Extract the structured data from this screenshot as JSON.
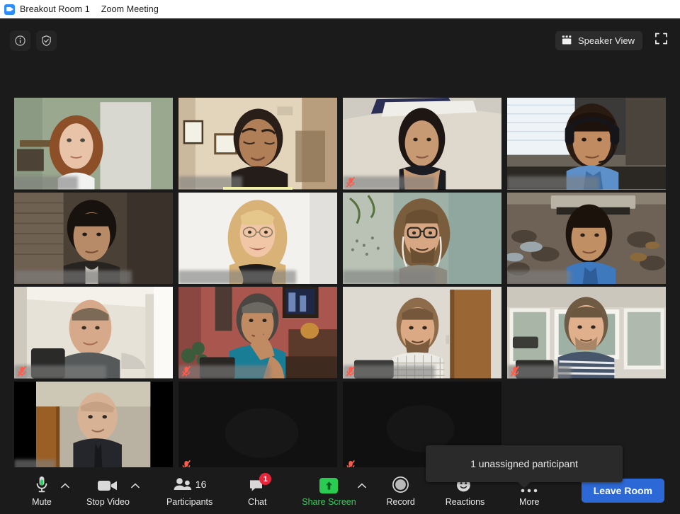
{
  "titlebar": {
    "room": "Breakout Room 1",
    "app": "Zoom Meeting",
    "logo_icon": "zoom-camera-icon"
  },
  "topbar": {
    "info_icon": "info-circle-icon",
    "encryption_icon": "shield-check-icon",
    "view_button": {
      "label": "Speaker View",
      "icon": "gallery-grid-icon"
    },
    "fullscreen_icon": "fullscreen-expand-icon"
  },
  "tooltip": {
    "text": "1 unassigned participant"
  },
  "gallery": {
    "rows": 4,
    "columns": 4,
    "tiles": [
      {
        "id": 1,
        "video": true,
        "muted": false,
        "active_speaker": false,
        "speaking_bar": false,
        "name_label_width": "w-sm"
      },
      {
        "id": 2,
        "video": true,
        "muted": false,
        "active_speaker": false,
        "speaking_bar": true,
        "name_label_width": "w-sm"
      },
      {
        "id": 3,
        "video": true,
        "muted": true,
        "active_speaker": false,
        "speaking_bar": false,
        "name_label_width": "w-md"
      },
      {
        "id": 4,
        "video": true,
        "muted": false,
        "active_speaker": true,
        "speaking_bar": false,
        "name_label_width": "w-md"
      },
      {
        "id": 5,
        "video": true,
        "muted": false,
        "active_speaker": false,
        "speaking_bar": false,
        "name_label_width": "w-lg"
      },
      {
        "id": 6,
        "video": true,
        "muted": false,
        "active_speaker": false,
        "speaking_bar": false,
        "name_label_width": "w-lg"
      },
      {
        "id": 7,
        "video": true,
        "muted": false,
        "active_speaker": false,
        "speaking_bar": false,
        "name_label_width": "w-md"
      },
      {
        "id": 8,
        "video": true,
        "muted": false,
        "active_speaker": false,
        "speaking_bar": false,
        "name_label_width": "w-sm"
      },
      {
        "id": 9,
        "video": true,
        "muted": true,
        "active_speaker": false,
        "speaking_bar": false,
        "name_label_width": "w-md"
      },
      {
        "id": 10,
        "video": true,
        "muted": true,
        "active_speaker": false,
        "speaking_bar": false,
        "name_label_width": "w-md"
      },
      {
        "id": 11,
        "video": true,
        "muted": true,
        "active_speaker": false,
        "speaking_bar": false,
        "name_label_width": "w-md"
      },
      {
        "id": 12,
        "video": true,
        "muted": true,
        "active_speaker": false,
        "speaking_bar": false,
        "name_label_width": "w-sm"
      },
      {
        "id": 13,
        "video": true,
        "muted": false,
        "active_speaker": false,
        "speaking_bar": false,
        "name_label_width": "w-xs"
      },
      {
        "id": 14,
        "video": false,
        "muted": true,
        "active_speaker": false,
        "speaking_bar": false,
        "name_label_width": "none"
      },
      {
        "id": 15,
        "video": false,
        "muted": true,
        "active_speaker": false,
        "speaking_bar": false,
        "name_label_width": "none"
      },
      {
        "id": 16,
        "video": false,
        "muted": false,
        "active_speaker": false,
        "speaking_bar": false,
        "name_label_width": "none"
      }
    ]
  },
  "toolbar": {
    "mute": {
      "label": "Mute",
      "icon": "microphone-icon"
    },
    "mute_caret": {
      "icon": "chevron-up-icon"
    },
    "video": {
      "label": "Stop Video",
      "icon": "video-camera-icon"
    },
    "video_caret": {
      "icon": "chevron-up-icon"
    },
    "participants": {
      "label": "Participants",
      "icon": "people-icon",
      "count": "16"
    },
    "chat": {
      "label": "Chat",
      "icon": "chat-bubble-icon",
      "badge": "1"
    },
    "share": {
      "label": "Share Screen",
      "icon": "share-arrow-up-icon"
    },
    "share_caret": {
      "icon": "chevron-up-icon"
    },
    "record": {
      "label": "Record",
      "icon": "record-circle-icon"
    },
    "reactions": {
      "label": "Reactions",
      "icon": "smiley-plus-icon"
    },
    "more": {
      "label": "More",
      "icon": "ellipsis-icon"
    },
    "leave": {
      "label": "Leave Room"
    }
  },
  "colors": {
    "accent_blue": "#2d69d6",
    "share_green": "#3ec95f",
    "badge_red": "#e8253a",
    "active_speaker_border": "#c8e36a",
    "speaking_bar": "#f2f0a8",
    "chrome_dark": "#1b1b1b"
  }
}
